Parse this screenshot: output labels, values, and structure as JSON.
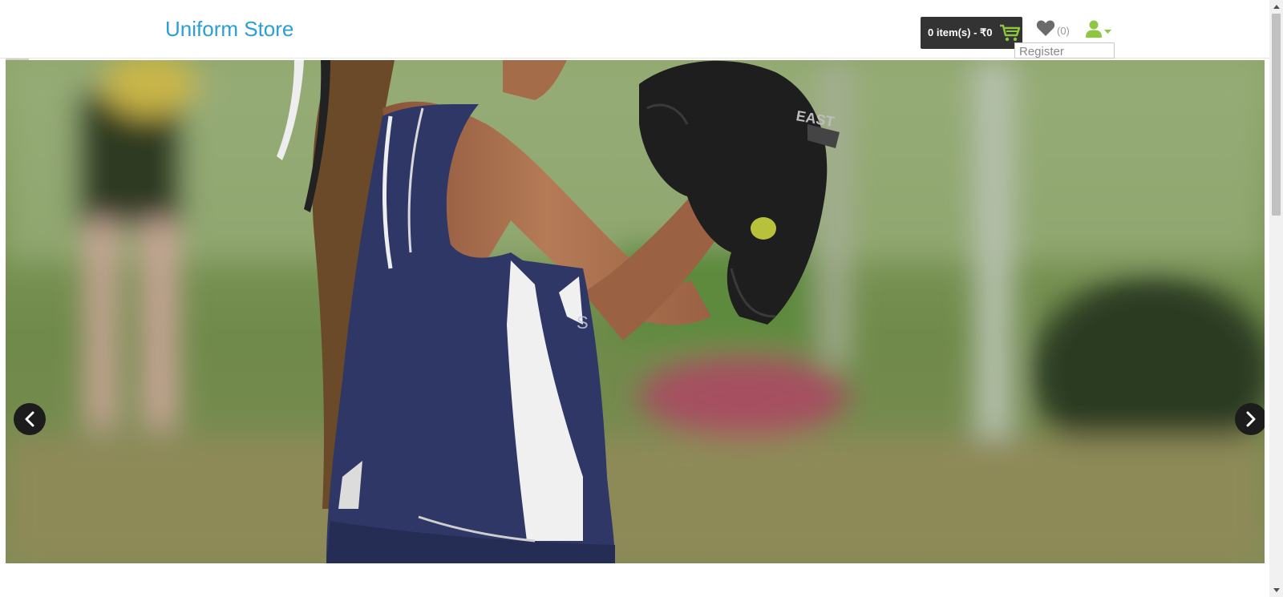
{
  "header": {
    "logo_text": "Uniform Store",
    "cart_label": "0 item(s) - ₹0",
    "wishlist_count": "(0)",
    "register_label": "Register"
  },
  "banner": {
    "prev_icon": "chevron-left-icon",
    "next_icon": "chevron-right-icon"
  },
  "colors": {
    "brand": "#2a9fd6",
    "accent_green": "#8dc63f",
    "dark": "#333333"
  }
}
